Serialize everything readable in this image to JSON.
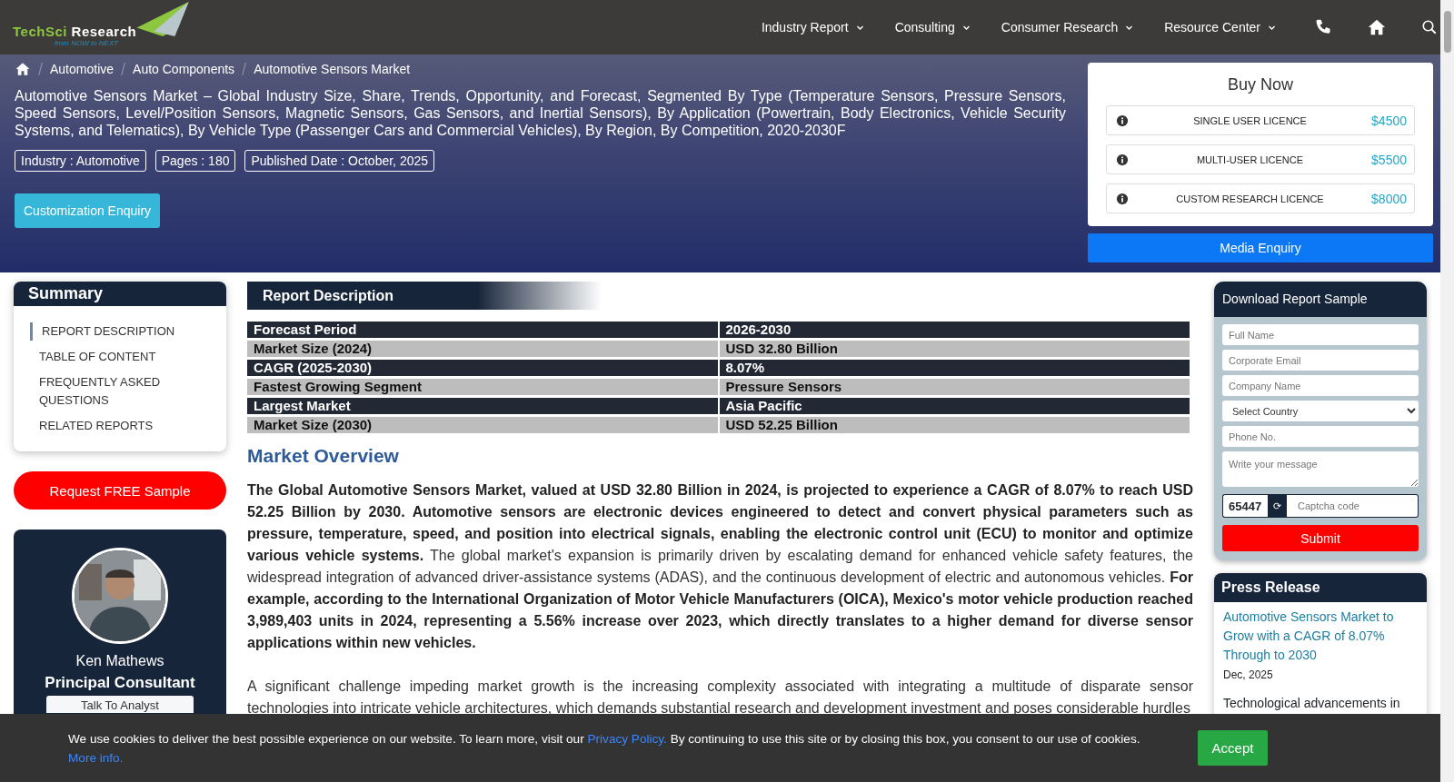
{
  "logo": {
    "name_a": "TechSci",
    "name_b": "Research",
    "tagline": "from NOW to NEXT"
  },
  "nav": [
    {
      "label": "Industry Report"
    },
    {
      "label": "Consulting"
    },
    {
      "label": "Consumer Research"
    },
    {
      "label": "Resource Center"
    }
  ],
  "breadcrumb": [
    "Automotive",
    "Auto Components",
    "Automotive Sensors Market"
  ],
  "title": "Automotive Sensors Market – Global Industry Size, Share, Trends, Opportunity, and Forecast, Segmented By Type (Temperature Sensors, Pressure Sensors, Speed Sensors, Level/Position Sensors, Magnetic Sensors, Gas Sensors, and Inertial Sensors), By Application (Powertrain, Body Electronics, Vehicle Security Systems, and Telematics), By Vehicle Type (Passenger Cars and Commercial Vehicles), By Region, By Competition, 2020-2030F",
  "tags": [
    "Industry : Automotive",
    "Pages : 180",
    "Published Date : October, 2025"
  ],
  "customization_button": "Customization Enquiry",
  "buy_now": {
    "title": "Buy Now",
    "licences": [
      {
        "name": "SINGLE USER LICENCE",
        "price": "$4500"
      },
      {
        "name": "MULTI-USER LICENCE",
        "price": "$5500"
      },
      {
        "name": "CUSTOM RESEARCH LICENCE",
        "price": "$8000"
      }
    ]
  },
  "media_button": "Media Enquiry",
  "summary": {
    "title": "Summary",
    "items": [
      {
        "label": "REPORT DESCRIPTION",
        "selected": true
      },
      {
        "label": "TABLE OF CONTENT",
        "selected": false
      },
      {
        "label": "FREQUENTLY ASKED QUESTIONS",
        "selected": false
      },
      {
        "label": "RELATED REPORTS",
        "selected": false
      }
    ]
  },
  "sample_button": "Request FREE Sample",
  "analyst": {
    "name": "Ken Mathews",
    "role": "Principal Consultant",
    "button": "Talk To Analyst"
  },
  "section_title": "Report Description",
  "table": {
    "rows": [
      [
        "Forecast Period",
        "2026-2030"
      ],
      [
        "Market Size (2024)",
        "USD 32.80 Billion"
      ],
      [
        "CAGR (2025-2030)",
        "8.07%"
      ],
      [
        "Fastest Growing Segment",
        "Pressure Sensors"
      ],
      [
        "Largest Market",
        "Asia Pacific"
      ],
      [
        "Market Size (2030)",
        "USD 52.25 Billion"
      ]
    ]
  },
  "overview_title": "Market Overview",
  "paragraphs": [
    "**The Global Automotive Sensors Market, valued at USD 32.80 Billion in 2024, is projected to experience a CAGR of 8.07% to reach USD 52.25 Billion by 2030. Automotive sensors are electronic devices engineered to detect and convert physical parameters such as pressure, temperature, speed, and position into electrical signals, enabling the electronic control unit (ECU) to monitor and optimize various vehicle systems.** The global market's expansion is primarily driven by escalating demand for enhanced vehicle safety features, the widespread integration of advanced driver-assistance systems (ADAS), and the continuous development of electric and autonomous vehicles. **For example, according to the International Organization of Motor Vehicle Manufacturers (OICA), Mexico's motor vehicle production reached 3,989,403 units in 2024, representing a 5.56% increase over 2023, which directly translates to a higher demand for diverse sensor applications within new vehicles.**",
    "A significant challenge impeding market growth is the increasing complexity associated with integrating a multitude of disparate sensor technologies into intricate vehicle architectures, which demands substantial research and development investment and poses considerable hurdles"
  ],
  "sample_form": {
    "title": "Download Report Sample",
    "fields": [
      {
        "kind": "input",
        "placeholder": "Full Name"
      },
      {
        "kind": "input",
        "placeholder": "Corporate Email"
      },
      {
        "kind": "input",
        "placeholder": "Company Name"
      },
      {
        "kind": "select",
        "value": "Select Country"
      },
      {
        "kind": "input",
        "placeholder": "Phone No."
      },
      {
        "kind": "textarea",
        "placeholder": "Write your message"
      }
    ],
    "captcha": "65447",
    "refresh": "⟳",
    "captcha_placeholder": "Captcha code",
    "submit": "Submit"
  },
  "press": {
    "title": "Press Release",
    "link": "Automotive Sensors Market to Grow with a CAGR of 8.07% Through to 2030",
    "date": "Dec, 2025",
    "excerpt": "Technological advancements in"
  },
  "cookie": {
    "text": "We use cookies to deliver the best possible experience on our website. To learn more, visit our",
    "link": "Privacy Policy.",
    "text_after": "By continuing to use this site or by closing this box, you consent to our use of cookies.",
    "more": "More info.",
    "accept": "Accept"
  }
}
